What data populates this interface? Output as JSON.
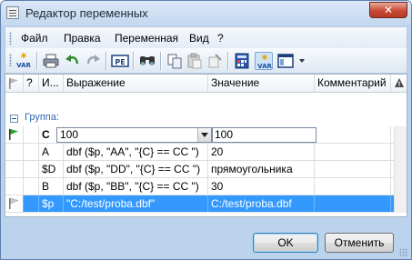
{
  "window": {
    "title": "Редактор переменных",
    "close_label": "✕"
  },
  "menu": [
    "Файл",
    "Правка",
    "Переменная",
    "Вид",
    "?"
  ],
  "toolbar": {
    "buttons": [
      "add-variable-icon",
      "print-icon",
      "undo-icon",
      "redo-icon",
      "pe-icon",
      "find-icon",
      "copy-icon",
      "paste-icon",
      "clear-icon",
      "calculator-icon",
      "variable-view-icon",
      "window-icon"
    ],
    "var_label": "VAR",
    "pe_label": "PE"
  },
  "columns": [
    "?",
    "И...",
    "Выражение",
    "Значение",
    "Комментарий"
  ],
  "group": {
    "label": "Группа:"
  },
  "rows": [
    {
      "name": "C",
      "expression": "100",
      "value": "100",
      "comment": ""
    },
    {
      "name": "A",
      "expression": "dbf ($p, \"AA\", \"{C} == CC \")",
      "value": "20",
      "comment": ""
    },
    {
      "name": "$D",
      "expression": "dbf ($p, \"DD\", \"{C} == CC \")",
      "value": "прямоугольника",
      "comment": ""
    },
    {
      "name": "B",
      "expression": "dbf ($p, \"BB\", \"{C} == CC \")",
      "value": "30",
      "comment": ""
    },
    {
      "name": "$p",
      "expression": "\"C:/test/proba.dbf\"",
      "value": "C:/test/proba.dbf",
      "comment": ""
    }
  ],
  "buttons": {
    "ok": "OK",
    "cancel": "Отменить"
  },
  "colors": {
    "selection": "#3399ff",
    "group_text": "#2f67b6",
    "window_frame": "#bcd3ee"
  }
}
